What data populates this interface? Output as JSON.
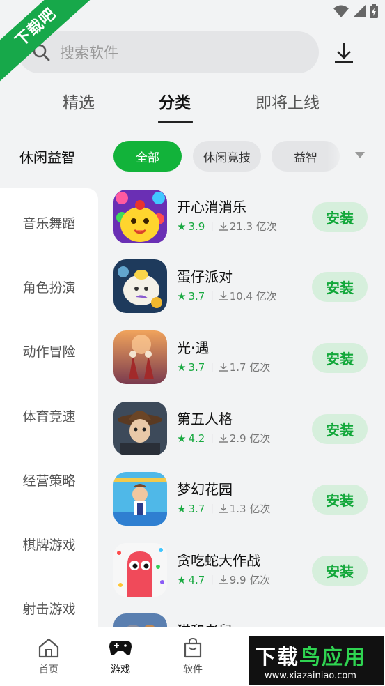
{
  "watermark": {
    "corner_text": "下载吧",
    "brand_white": "下载",
    "brand_green": "鸟应用",
    "url": "www.xiazainiao.com"
  },
  "search": {
    "placeholder": "搜索软件"
  },
  "tabs": [
    {
      "label": "精选"
    },
    {
      "label": "分类"
    },
    {
      "label": "即将上线"
    }
  ],
  "active_tab": "分类",
  "filter": {
    "title": "休闲益智",
    "chips": [
      {
        "label": "全部"
      },
      {
        "label": "休闲竞技"
      },
      {
        "label": "益智"
      }
    ],
    "selected": "全部"
  },
  "sidebar": {
    "items": [
      {
        "label": "音乐舞蹈"
      },
      {
        "label": "角色扮演"
      },
      {
        "label": "动作冒险"
      },
      {
        "label": "体育竞速"
      },
      {
        "label": "经营策略"
      },
      {
        "label": "棋牌游戏"
      },
      {
        "label": "射击游戏"
      }
    ]
  },
  "apps": [
    {
      "name": "开心消消乐",
      "rating": "3.9",
      "downloads": "21.3 亿次",
      "button": "安装"
    },
    {
      "name": "蛋仔派对",
      "rating": "3.7",
      "downloads": "10.4 亿次",
      "button": "安装"
    },
    {
      "name": "光·遇",
      "rating": "3.7",
      "downloads": "1.7 亿次",
      "button": "安装"
    },
    {
      "name": "第五人格",
      "rating": "4.2",
      "downloads": "2.9 亿次",
      "button": "安装"
    },
    {
      "name": "梦幻花园",
      "rating": "3.7",
      "downloads": "1.3 亿次",
      "button": "安装"
    },
    {
      "name": "贪吃蛇大作战",
      "rating": "4.7",
      "downloads": "9.9 亿次",
      "button": "安装"
    },
    {
      "name": "猫和老鼠",
      "rating": "",
      "downloads": "",
      "button": ""
    }
  ],
  "bottom_nav": [
    {
      "label": "首页",
      "icon": "home-icon"
    },
    {
      "label": "游戏",
      "icon": "gamepad-icon"
    },
    {
      "label": "软件",
      "icon": "shopping-bag-icon"
    }
  ],
  "active_nav": "游戏",
  "colors": {
    "accent": "#12b33a",
    "install_bg": "#d6efdc",
    "banner": "#17a84a"
  }
}
